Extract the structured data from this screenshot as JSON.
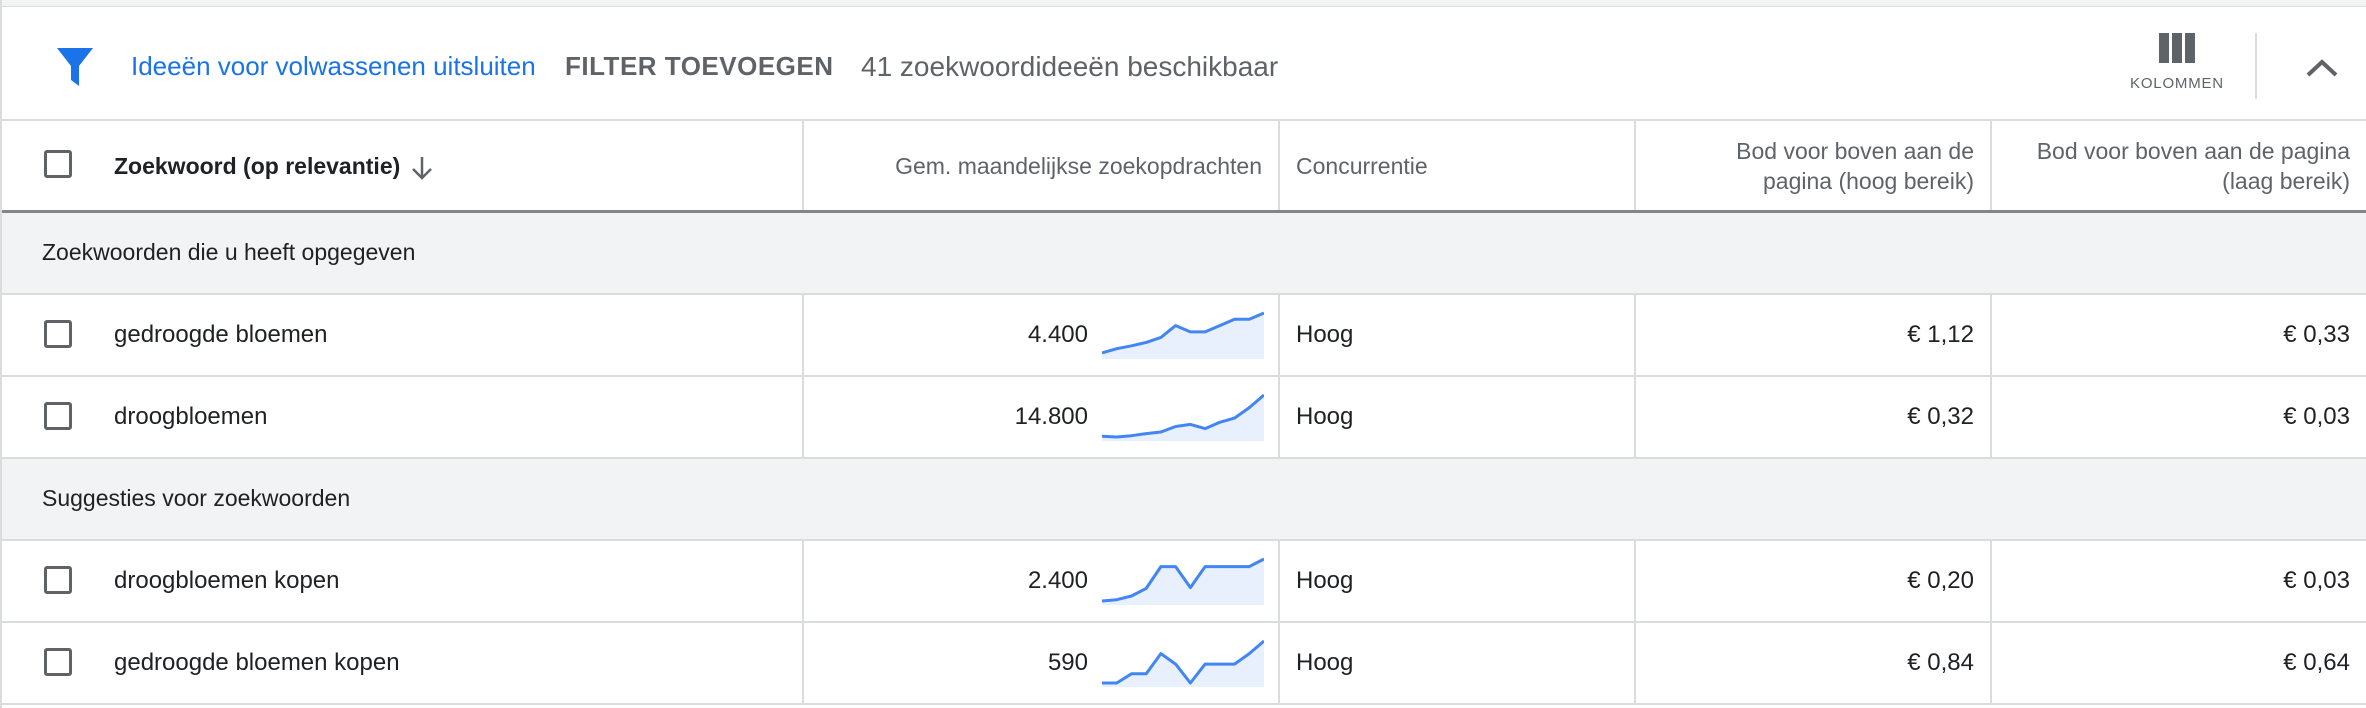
{
  "toolbar": {
    "adult_filter_link": "Ideeën voor volwassenen uitsluiten",
    "add_filter_label": "FILTER TOEVOEGEN",
    "available_count": "41 zoekwoordideeën beschikbaar",
    "columns_label": "KOLOMMEN",
    "filter_icon": "filter-icon",
    "columns_icon": "columns-icon",
    "collapse_icon": "chevron-up-icon",
    "accent_color": "#1a73e8"
  },
  "table": {
    "headers": {
      "keyword": "Zoekwoord (op relevantie)",
      "searches": "Gem. maandelijkse zoekopdrachten",
      "competition": "Concurrentie",
      "bid_high_line1": "Bod voor boven aan de",
      "bid_high_line2": "pagina (hoog bereik)",
      "bid_low_line1": "Bod voor boven aan de pagina",
      "bid_low_line2": "(laag bereik)"
    },
    "groups": [
      {
        "label": "Zoekwoorden die u heeft opgegeven",
        "rows": [
          {
            "keyword": "gedroogde bloemen",
            "searches": "4.400",
            "competition": "Hoog",
            "bid_low": "€ 1,12",
            "bid_high": "€ 0,33",
            "trend": [
              0.05,
              0.15,
              0.22,
              0.3,
              0.42,
              0.7,
              0.55,
              0.55,
              0.7,
              0.85,
              0.85,
              1.0
            ]
          },
          {
            "keyword": "droogbloemen",
            "searches": "14.800",
            "competition": "Hoog",
            "bid_low": "€ 0,32",
            "bid_high": "€ 0,03",
            "trend": [
              0.02,
              0.0,
              0.03,
              0.08,
              0.12,
              0.25,
              0.3,
              0.2,
              0.35,
              0.45,
              0.7,
              1.0
            ]
          }
        ]
      },
      {
        "label": "Suggesties voor zoekwoorden",
        "rows": [
          {
            "keyword": "droogbloemen kopen",
            "searches": "2.400",
            "competition": "Hoog",
            "bid_low": "€ 0,20",
            "bid_high": "€ 0,03",
            "trend": [
              0.0,
              0.03,
              0.12,
              0.3,
              0.82,
              0.82,
              0.32,
              0.82,
              0.82,
              0.82,
              0.82,
              1.0
            ]
          },
          {
            "keyword": "gedroogde bloemen kopen",
            "searches": "590",
            "competition": "Hoog",
            "bid_low": "€ 0,84",
            "bid_high": "€ 0,64",
            "trend": [
              0.0,
              0.0,
              0.22,
              0.22,
              0.7,
              0.45,
              0.0,
              0.45,
              0.45,
              0.45,
              0.7,
              1.0
            ]
          }
        ]
      }
    ]
  }
}
